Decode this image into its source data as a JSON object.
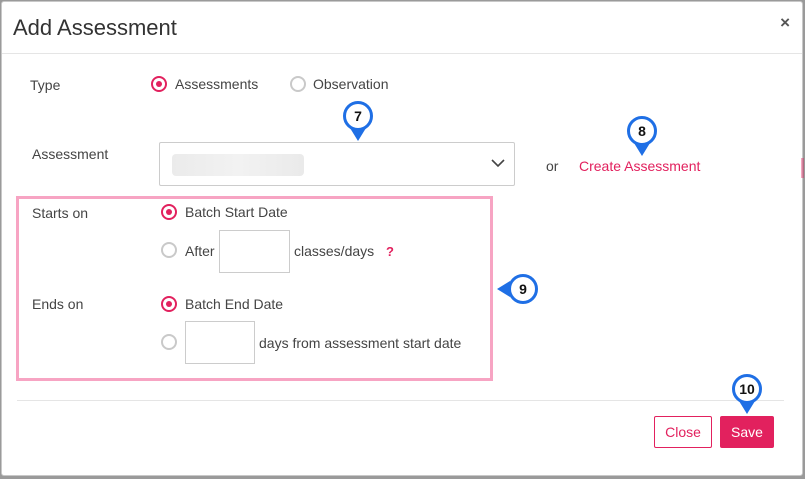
{
  "modal": {
    "title": "Add Assessment",
    "close_glyph": "×"
  },
  "form": {
    "type_label": "Type",
    "type_options": [
      "Assessments",
      "Observation"
    ],
    "type_selected": "Assessments",
    "assessment_label": "Assessment",
    "assessment_value": "",
    "or_text": "or",
    "create_link": "Create Assessment",
    "starts_on_label": "Starts on",
    "starts_option_batch": "Batch Start Date",
    "starts_option_after": "After",
    "starts_after_suffix": "classes/days",
    "starts_after_value": "",
    "help_mark": "?",
    "ends_on_label": "Ends on",
    "ends_option_batch": "Batch End Date",
    "ends_days_suffix": "days from assessment start date",
    "ends_days_value": ""
  },
  "footer": {
    "close_label": "Close",
    "save_label": "Save"
  },
  "markers": [
    "7",
    "8",
    "9",
    "10"
  ],
  "colors": {
    "accent": "#e2215e",
    "highlight": "#f7a4c3",
    "marker_border": "#1f6fe5"
  },
  "icons": {
    "dropdown": "chevron-down-icon",
    "dismiss": "close-icon",
    "help": "question-icon"
  }
}
